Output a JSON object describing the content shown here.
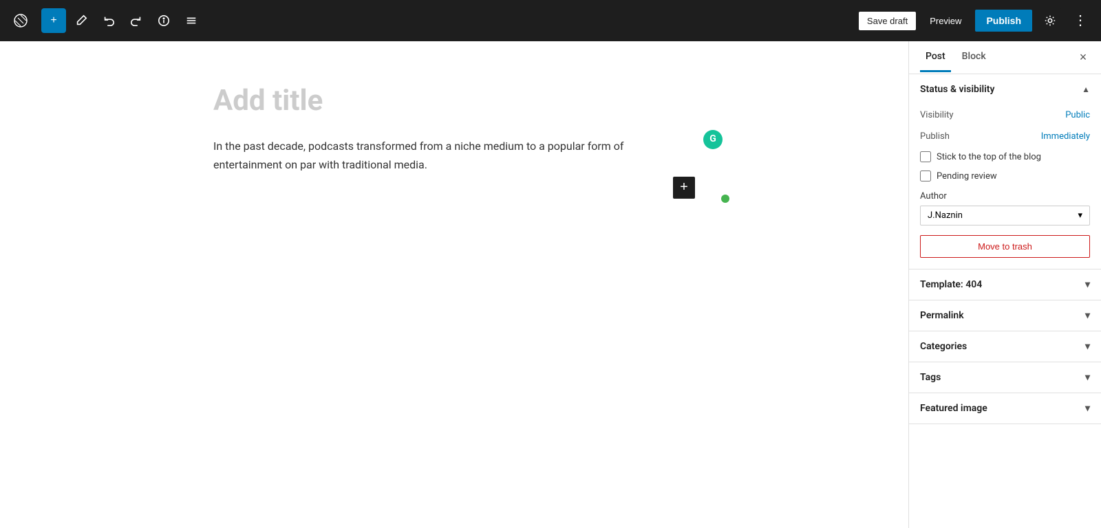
{
  "toolbar": {
    "wp_logo": "W",
    "add_label": "+",
    "edit_label": "✏",
    "undo_label": "↩",
    "redo_label": "↪",
    "info_label": "ℹ",
    "list_view_label": "≡",
    "save_draft_label": "Save draft",
    "preview_label": "Preview",
    "publish_label": "Publish",
    "settings_icon": "⚙",
    "more_icon": "⋮"
  },
  "editor": {
    "title_placeholder": "Add title",
    "body_text": "In the past decade, podcasts transformed from a niche medium to a popular form of entertainment on par with traditional media.",
    "add_block_label": "+",
    "grammarly_label": "G"
  },
  "sidebar": {
    "tab_post": "Post",
    "tab_block": "Block",
    "close_label": "×",
    "status_visibility": {
      "section_title": "Status & visibility",
      "visibility_label": "Visibility",
      "visibility_value": "Public",
      "publish_label": "Publish",
      "publish_value": "Immediately",
      "stick_to_top_label": "Stick to the top of the blog",
      "pending_review_label": "Pending review",
      "author_label": "Author",
      "author_value": "J.Naznin",
      "author_chevron": "▾",
      "move_to_trash_label": "Move to trash"
    },
    "template": {
      "section_title": "Template: 404",
      "chevron": "▾"
    },
    "permalink": {
      "section_title": "Permalink",
      "chevron": "▾"
    },
    "categories": {
      "section_title": "Categories",
      "chevron": "▾"
    },
    "tags": {
      "section_title": "Tags",
      "chevron": "▾"
    },
    "featured_image": {
      "section_title": "Featured image",
      "chevron": "▾"
    }
  },
  "colors": {
    "accent_blue": "#007cba",
    "toolbar_bg": "#1e1e1e",
    "trash_red": "#cc1818",
    "grammarly_green": "#15c39a",
    "active_tab_border": "#007cba",
    "green_dot": "#46b450"
  }
}
